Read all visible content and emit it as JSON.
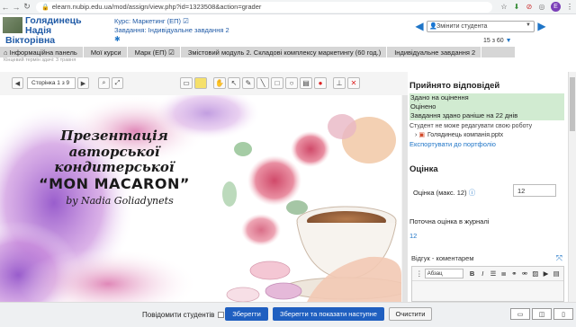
{
  "browser": {
    "url": "elearn.nubip.edu.ua/mod/assign/view.php?id=1323508&action=grader",
    "profile_initial": "E"
  },
  "header": {
    "user_name_lines": [
      "Голядинець",
      "Надія",
      "Вікторівна"
    ],
    "course": "Курс: Маркетинг (ЕП) ☑",
    "assignment": "Завдання: Індивідуальне завдання 2",
    "student_select": "Змінити студента",
    "count": "15 з 60"
  },
  "breadcrumb": [
    "⌂ Інформаційна панель",
    "Мої курси",
    "Марк (ЕП) ☑",
    "Змістовий модуль 2. Складові комплексу маркетингу (60 год.)",
    "Індивідуальне завдання 2"
  ],
  "sub_strip": "Кінцевий термін здачі: 3 травня",
  "pdf": {
    "page_label": "Сторінка 1 з 9",
    "title_line1": "Презентація авторської",
    "title_line2": "кондитерської",
    "title_line3": "“MON MACARON”",
    "title_line4": "by Nadia Goliadynets"
  },
  "panel": {
    "submission_title": "Прийнято відповідей",
    "status_lines": [
      "Здано на оцінення",
      "Оцінено",
      "Завдання здано раніше на 22 днів"
    ],
    "no_edit": "Студент не може редагувати свою роботу",
    "file_name": "Голядинець компанія.pptx",
    "export_link": "Експортувати до портфоліо",
    "grade_title": "Оцінка",
    "grade_label": "Оцінка (макс. 12)",
    "grade_value": "12",
    "current_grade_label": "Поточна оцінка в журналі",
    "current_grade_value": "12",
    "feedback_label": "Відгук - коментарем",
    "editor_style": "Абзац"
  },
  "footer": {
    "notify_label": "Повідомити студентів",
    "save": "Зберегти",
    "save_next": "Зберегти та показати наступне",
    "reset": "Очистити"
  }
}
